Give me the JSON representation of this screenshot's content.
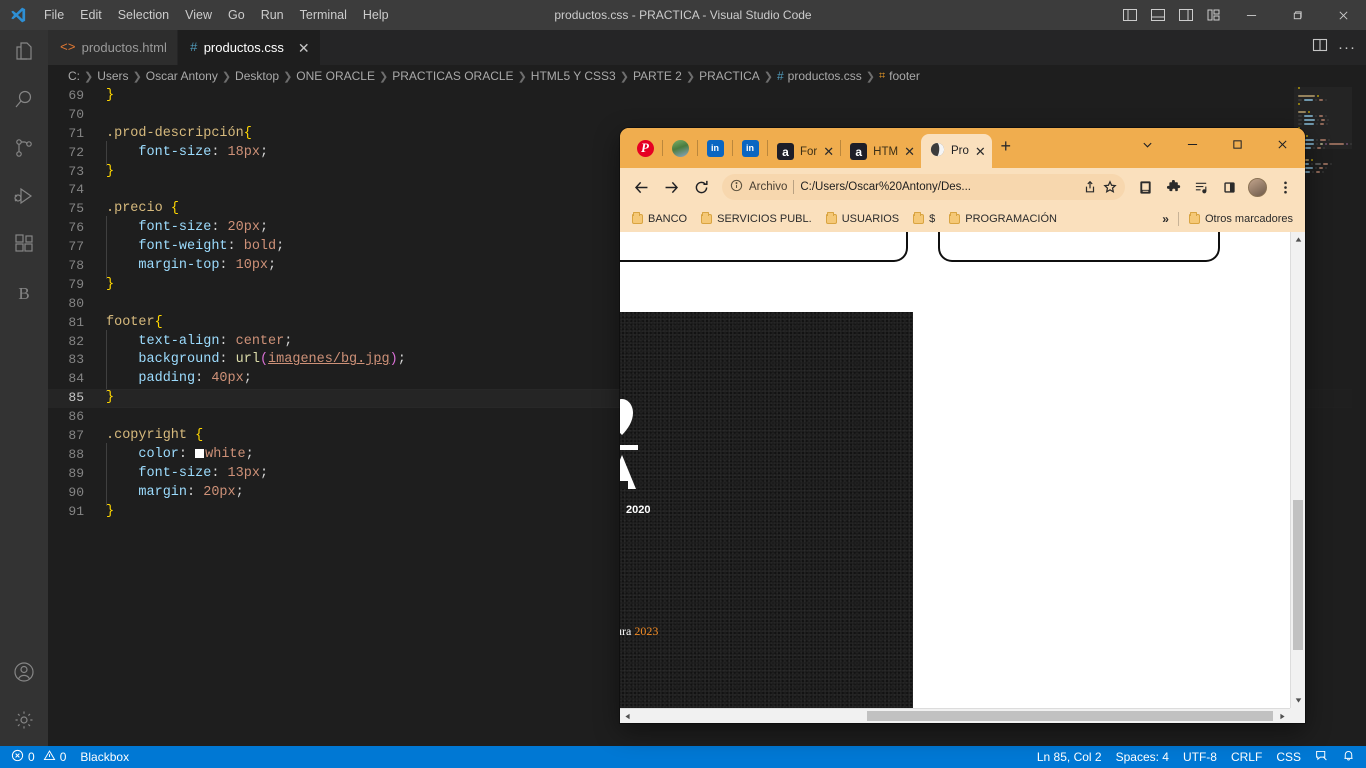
{
  "vscode": {
    "window_title": "productos.css - PRACTICA - Visual Studio Code",
    "menu": [
      "File",
      "Edit",
      "Selection",
      "View",
      "Go",
      "Run",
      "Terminal",
      "Help"
    ],
    "activity_bar": [
      {
        "name": "explorer",
        "icon": "files-icon"
      },
      {
        "name": "search",
        "icon": "search-icon"
      },
      {
        "name": "source-control",
        "icon": "source-control-icon"
      },
      {
        "name": "run-debug",
        "icon": "run-debug-icon"
      },
      {
        "name": "extensions",
        "icon": "extensions-icon"
      },
      {
        "name": "blackbox",
        "icon": "blackbox-icon",
        "letter": "B"
      }
    ],
    "activity_bar_bottom": [
      {
        "name": "accounts",
        "icon": "account-icon"
      },
      {
        "name": "settings",
        "icon": "gear-icon"
      }
    ],
    "tabs": [
      {
        "label": "productos.html",
        "type": "html",
        "glyph": "<>",
        "active": false,
        "dirty": false
      },
      {
        "label": "productos.css",
        "type": "css",
        "glyph": "#",
        "active": true,
        "dirty": false
      }
    ],
    "breadcrumb": [
      "C:",
      "Users",
      "Oscar Antony",
      "Desktop",
      "ONE ORACLE",
      "PRACTICAS ORACLE",
      "HTML5 Y CSS3",
      "PARTE 2",
      "PRACTICA"
    ],
    "breadcrumb_file": "productos.css",
    "breadcrumb_file_glyph": "#",
    "breadcrumb_symbol": "footer",
    "code_lines": [
      {
        "n": 69,
        "segs": [
          {
            "t": "}",
            "c": "brace"
          }
        ]
      },
      {
        "n": 70,
        "segs": []
      },
      {
        "n": 71,
        "segs": [
          {
            "t": ".prod-descripción",
            "c": "sel"
          },
          {
            "t": "{",
            "c": "brace"
          }
        ]
      },
      {
        "n": 72,
        "indent": true,
        "segs": [
          {
            "t": "    ",
            "c": "punc"
          },
          {
            "t": "font-size",
            "c": "prop"
          },
          {
            "t": ": ",
            "c": "punc"
          },
          {
            "t": "18px",
            "c": "val"
          },
          {
            "t": ";",
            "c": "punc"
          }
        ]
      },
      {
        "n": 73,
        "segs": [
          {
            "t": "}",
            "c": "brace"
          }
        ]
      },
      {
        "n": 74,
        "segs": []
      },
      {
        "n": 75,
        "segs": [
          {
            "t": ".precio ",
            "c": "sel"
          },
          {
            "t": "{",
            "c": "brace"
          }
        ]
      },
      {
        "n": 76,
        "indent": true,
        "segs": [
          {
            "t": "    ",
            "c": "punc"
          },
          {
            "t": "font-size",
            "c": "prop"
          },
          {
            "t": ": ",
            "c": "punc"
          },
          {
            "t": "20px",
            "c": "val"
          },
          {
            "t": ";",
            "c": "punc"
          }
        ]
      },
      {
        "n": 77,
        "indent": true,
        "segs": [
          {
            "t": "    ",
            "c": "punc"
          },
          {
            "t": "font-weight",
            "c": "prop"
          },
          {
            "t": ": ",
            "c": "punc"
          },
          {
            "t": "bold",
            "c": "val"
          },
          {
            "t": ";",
            "c": "punc"
          }
        ]
      },
      {
        "n": 78,
        "indent": true,
        "segs": [
          {
            "t": "    ",
            "c": "punc"
          },
          {
            "t": "margin-top",
            "c": "prop"
          },
          {
            "t": ": ",
            "c": "punc"
          },
          {
            "t": "10px",
            "c": "val"
          },
          {
            "t": ";",
            "c": "punc"
          }
        ]
      },
      {
        "n": 79,
        "segs": [
          {
            "t": "}",
            "c": "brace"
          }
        ]
      },
      {
        "n": 80,
        "segs": []
      },
      {
        "n": 81,
        "segs": [
          {
            "t": "footer",
            "c": "sel"
          },
          {
            "t": "{",
            "c": "brace"
          }
        ]
      },
      {
        "n": 82,
        "indent": true,
        "segs": [
          {
            "t": "    ",
            "c": "punc"
          },
          {
            "t": "text-align",
            "c": "prop"
          },
          {
            "t": ": ",
            "c": "punc"
          },
          {
            "t": "center",
            "c": "val"
          },
          {
            "t": ";",
            "c": "punc"
          }
        ]
      },
      {
        "n": 83,
        "indent": true,
        "segs": [
          {
            "t": "    ",
            "c": "punc"
          },
          {
            "t": "background",
            "c": "prop"
          },
          {
            "t": ": ",
            "c": "punc"
          },
          {
            "t": "url",
            "c": "fn"
          },
          {
            "t": "(",
            "c": "paren"
          },
          {
            "t": "imagenes/bg.jpg",
            "c": "link"
          },
          {
            "t": ")",
            "c": "paren"
          },
          {
            "t": ";",
            "c": "punc"
          }
        ]
      },
      {
        "n": 84,
        "indent": true,
        "segs": [
          {
            "t": "    ",
            "c": "punc"
          },
          {
            "t": "padding",
            "c": "prop"
          },
          {
            "t": ": ",
            "c": "punc"
          },
          {
            "t": "40px",
            "c": "val"
          },
          {
            "t": ";",
            "c": "punc"
          }
        ]
      },
      {
        "n": 85,
        "current": true,
        "segs": [
          {
            "t": "}",
            "c": "brace"
          }
        ]
      },
      {
        "n": 86,
        "segs": []
      },
      {
        "n": 87,
        "segs": [
          {
            "t": ".copyright ",
            "c": "sel"
          },
          {
            "t": "{",
            "c": "brace"
          }
        ]
      },
      {
        "n": 88,
        "indent": true,
        "segs": [
          {
            "t": "    ",
            "c": "punc"
          },
          {
            "t": "color",
            "c": "prop"
          },
          {
            "t": ": ",
            "c": "punc"
          },
          {
            "t": "SWATCH",
            "c": "swatch"
          },
          {
            "t": "white",
            "c": "val"
          },
          {
            "t": ";",
            "c": "punc"
          }
        ]
      },
      {
        "n": 89,
        "indent": true,
        "segs": [
          {
            "t": "    ",
            "c": "punc"
          },
          {
            "t": "font-size",
            "c": "prop"
          },
          {
            "t": ": ",
            "c": "punc"
          },
          {
            "t": "13px",
            "c": "val"
          },
          {
            "t": ";",
            "c": "punc"
          }
        ]
      },
      {
        "n": 90,
        "indent": true,
        "segs": [
          {
            "t": "    ",
            "c": "punc"
          },
          {
            "t": "margin",
            "c": "prop"
          },
          {
            "t": ": ",
            "c": "punc"
          },
          {
            "t": "20px",
            "c": "val"
          },
          {
            "t": ";",
            "c": "punc"
          }
        ]
      },
      {
        "n": 91,
        "segs": [
          {
            "t": "}",
            "c": "brace"
          }
        ]
      }
    ],
    "status_bar": {
      "errors": "0",
      "warnings": "0",
      "blackbox": "Blackbox",
      "cursor": "Ln 85, Col 2",
      "spaces": "Spaces: 4",
      "encoding": "UTF-8",
      "eol": "CRLF",
      "language": "CSS",
      "accent": "#0078d4"
    }
  },
  "chrome": {
    "pinned_tabs": [
      {
        "name": "pinterest",
        "glyph": "P"
      },
      {
        "name": "profile-photo",
        "glyph": ""
      },
      {
        "name": "linkedin-1",
        "glyph": "in"
      },
      {
        "name": "linkedin-2",
        "glyph": "in"
      }
    ],
    "tabs": [
      {
        "label": "For",
        "favicon": "a",
        "active": false
      },
      {
        "label": "HTM",
        "favicon": "a",
        "active": false
      },
      {
        "label": "Pro",
        "favicon": "globe",
        "active": true
      }
    ],
    "toolbar": {
      "back": "back-arrow",
      "forward": "forward-arrow",
      "reload": "reload-icon",
      "omnibox_label": "Archivo",
      "omnibox_url": "C:/Users/Oscar%20Antony/Des...",
      "share": "share-icon",
      "bookmark": "star-icon"
    },
    "bookmarks": [
      "BANCO",
      "SERVICIOS PUBL.",
      "USUARIOS",
      "$",
      "PROGRAMACIÓN"
    ],
    "bookmarks_overflow": "»",
    "bookmarks_other": "Otros marcadores",
    "page": {
      "copyright_text": "ura ",
      "copyright_year": "2023",
      "logo_year": "2020",
      "footer_bg": "#1c1c1c"
    },
    "accent": "#f0ad4e",
    "toolbar_bg": "#fae0bd"
  }
}
